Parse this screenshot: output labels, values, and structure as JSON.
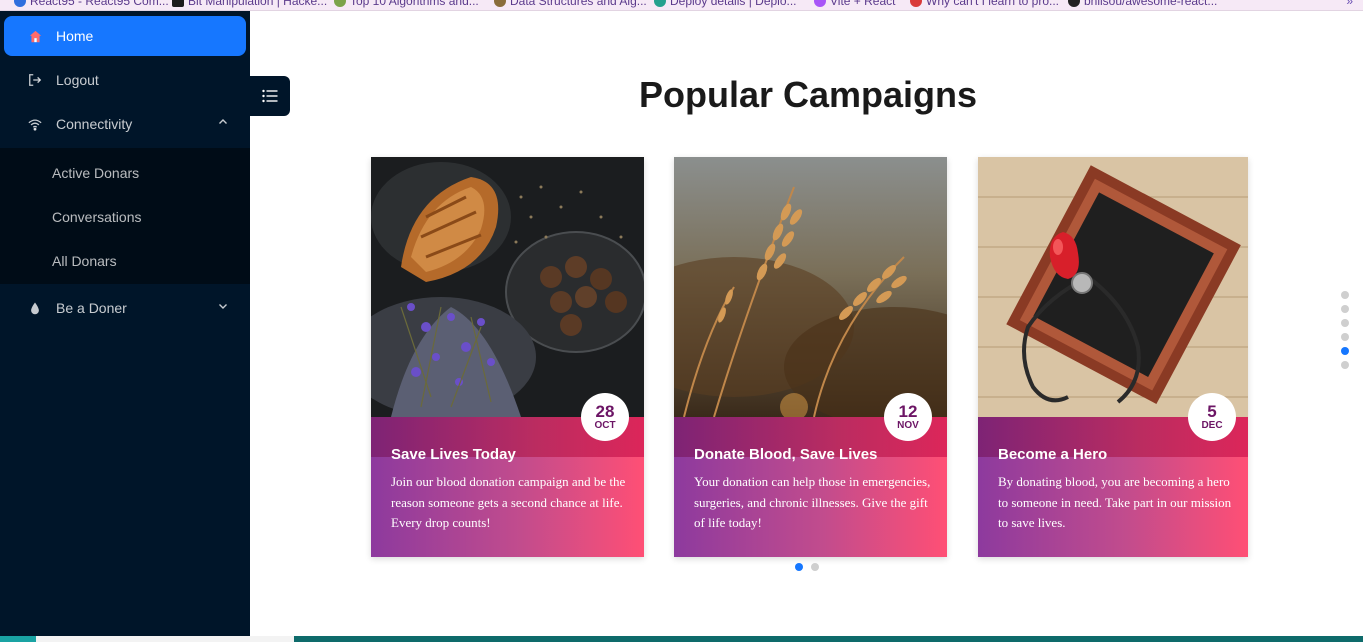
{
  "bookmarks": [
    {
      "label": "React95 - React95 Com...",
      "color": "#2f6fde"
    },
    {
      "label": "Bit Manipulation | Hacke...",
      "color": "#1c1c1c"
    },
    {
      "label": "Top 10 Algorithms and...",
      "color": "#7ba34a"
    },
    {
      "label": "Data Structures and Alg...",
      "color": "#8a6d3b"
    },
    {
      "label": "Deploy details | Deplo...",
      "color": "#25a18e"
    },
    {
      "label": "Vite + React",
      "color": "#a855f7"
    },
    {
      "label": "Why can't I learn to pro...",
      "color": "#d93a3a"
    },
    {
      "label": "bnilsou/awesome-react...",
      "color": "#222222"
    }
  ],
  "sidebar": {
    "home": "Home",
    "logout": "Logout",
    "connectivity": "Connectivity",
    "submenu": [
      "Active Donars",
      "Conversations",
      "All Donars"
    ],
    "be_a_doner": "Be a Doner"
  },
  "main": {
    "title": "Popular Campaigns"
  },
  "cards": [
    {
      "title": "Save Lives Today",
      "text": "Join our blood donation campaign and be the reason someone gets a second chance at life. Every drop counts!",
      "day": "28",
      "month": "OCT"
    },
    {
      "title": "Donate Blood, Save Lives",
      "text": "Your donation can help those in emergencies, surgeries, and chronic illnesses. Give the gift of life today!",
      "day": "12",
      "month": "NOV"
    },
    {
      "title": "Become a Hero",
      "text": "By donating blood, you are becoming a hero to someone in need. Take part in our mission to save lives.",
      "day": "5",
      "month": "DEC"
    }
  ],
  "carousel": {
    "pages": 2,
    "active_page": 1
  },
  "section_nav": {
    "sections": 6,
    "active_section": 5
  },
  "colors": {
    "sidebar_bg": "#001529",
    "accent": "#1677ff",
    "badge_text": "#6c1565"
  }
}
